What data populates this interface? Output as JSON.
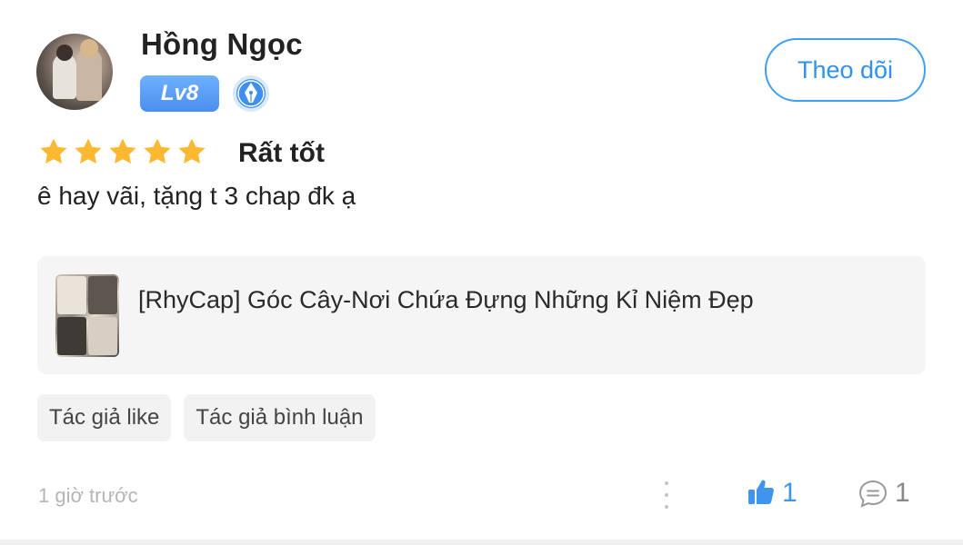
{
  "user": {
    "name": "Hồng Ngọc",
    "level": "Lv8"
  },
  "follow_button": "Theo dõi",
  "review": {
    "stars": 5,
    "rating_label": "Rất tốt",
    "comment": "ê hay vãi, tặng t 3 chap đk ạ"
  },
  "work": {
    "title": "[RhyCap] Góc Cây-Nơi Chứa Đựng Những Kỉ Niệm Đẹp"
  },
  "tags": [
    "Tác giả like",
    "Tác giả bình luận"
  ],
  "footer": {
    "timestamp": "1 giờ trước",
    "like_count": "1",
    "comment_count": "1"
  },
  "colors": {
    "accent_blue": "#3f95ee",
    "star_yellow": "#fbb932"
  }
}
